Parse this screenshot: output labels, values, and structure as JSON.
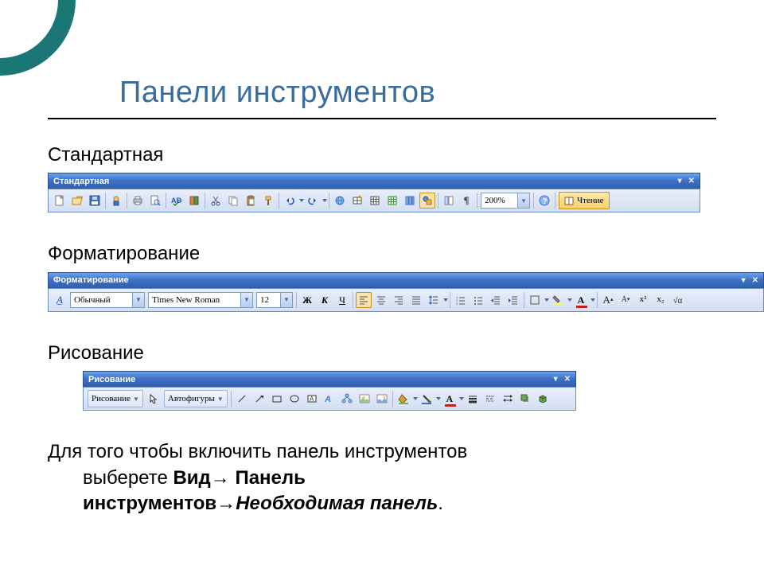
{
  "title": "Панели инструментов",
  "sections": {
    "standard": "Стандартная",
    "format": "Форматирование",
    "draw": "Рисование"
  },
  "toolbars": {
    "standard": {
      "title": "Стандартная",
      "zoom": "200%",
      "read": "Чтение"
    },
    "format": {
      "title": "Форматирование",
      "style": "Обычный",
      "font": "Times New Roman",
      "size": "12",
      "bold": "Ж",
      "italic": "К",
      "underline": "Ч",
      "fontA": "A",
      "sup": "x²",
      "sub": "x₂"
    },
    "draw": {
      "title": "Рисование",
      "menu": "Рисование",
      "autoshapes": "Автофигуры",
      "fontA": "A"
    }
  },
  "instruction": {
    "line1": "Для того чтобы включить панель инструментов",
    "line2a": "выберете ",
    "line2b": "Вид→ Панель",
    "line3a": "инструментов→",
    "line3b": "Необходимая панель",
    "end": "."
  }
}
